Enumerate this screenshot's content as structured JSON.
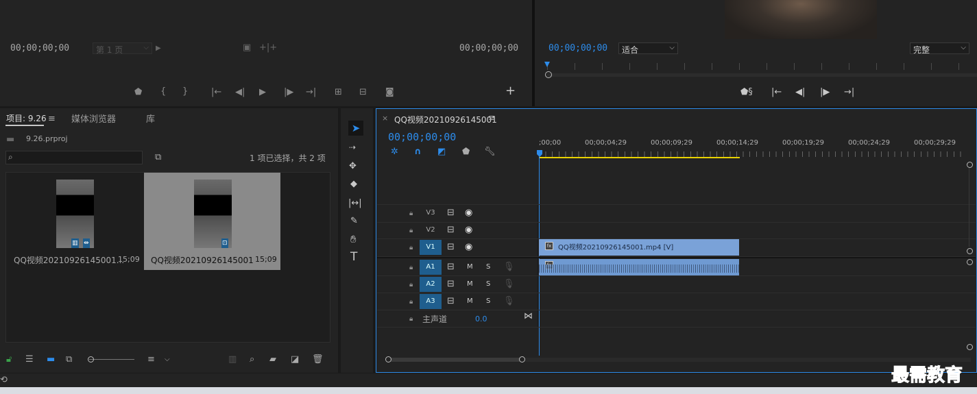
{
  "source_monitor": {
    "timecode_in": "00;00;00;00",
    "page_select": "第 1 页",
    "timecode_out": "00;00;00;00"
  },
  "program_monitor": {
    "timecode": "00;00;00;00",
    "fit_select": "适合",
    "quality_select": "完整"
  },
  "project_panel": {
    "tabs": [
      "项目: 9.26",
      "媒体浏览器",
      "库"
    ],
    "file_name": "9.26.prproj",
    "search_placeholder": "",
    "selection_status": "1 项已选择，共 2 项",
    "items": [
      {
        "name": "QQ视频20210926145001...",
        "duration": "15;09",
        "selected": false
      },
      {
        "name": "QQ视频20210926145001",
        "duration": "15;09",
        "selected": true
      }
    ]
  },
  "timeline": {
    "tab_title": "QQ视频20210926145001",
    "timecode": "00;00;00;00",
    "ruler_labels": [
      ";00;00",
      "00;00;04;29",
      "00;00;09;29",
      "00;00;14;29",
      "00;00;19;29",
      "00;00;24;29",
      "00;00;29;29"
    ],
    "video_tracks": [
      "V3",
      "V2",
      "V1"
    ],
    "audio_tracks": [
      "A1",
      "A2",
      "A3"
    ],
    "master_label": "主声道",
    "master_value": "0.0",
    "video_clip": "QQ视频20210926145001.mp4 [V]",
    "mute_label": "M",
    "solo_label": "S"
  },
  "watermark": "最需教育",
  "colors": {
    "accent": "#2d8ceb",
    "clip_video": "#7aa2d8",
    "clip_audio": "#6f9ad2",
    "work_area": "#e8d200"
  }
}
